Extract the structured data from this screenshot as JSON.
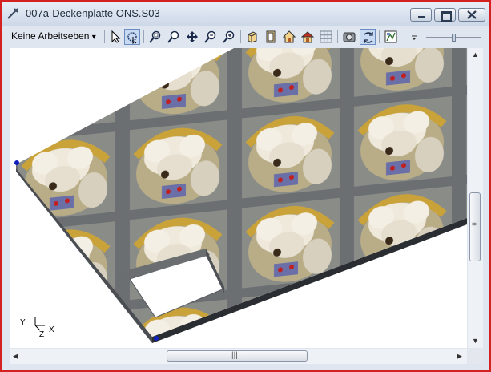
{
  "window": {
    "title": "007a-Deckenplatte ONS.S03",
    "controls": {
      "minimize_icon": "minimize-icon",
      "maximize_icon": "maximize-icon",
      "close_icon": "close-icon"
    }
  },
  "toolbar": {
    "layer_dropdown": "Keine Arbeitseben",
    "dropdown_arrow": "▾",
    "buttons": [
      "select-arrow-icon",
      "select-window-icon",
      "zoom-window-icon",
      "zoom-icon",
      "pan-icon",
      "zoom-all-icon",
      "zoom-previous-icon",
      "view-3d-icon",
      "view-front-icon",
      "view-home-icon",
      "view-house-icon",
      "grid-icon",
      "render-icon",
      "rotate-icon",
      "settings-icon"
    ],
    "zoom_slider_level": 0.5
  },
  "viewport": {
    "axis": {
      "y": "Y",
      "z": "Z",
      "x": "X"
    }
  },
  "scrollbars": {
    "horizontal_grip": "|||",
    "vertical_grip": "="
  }
}
